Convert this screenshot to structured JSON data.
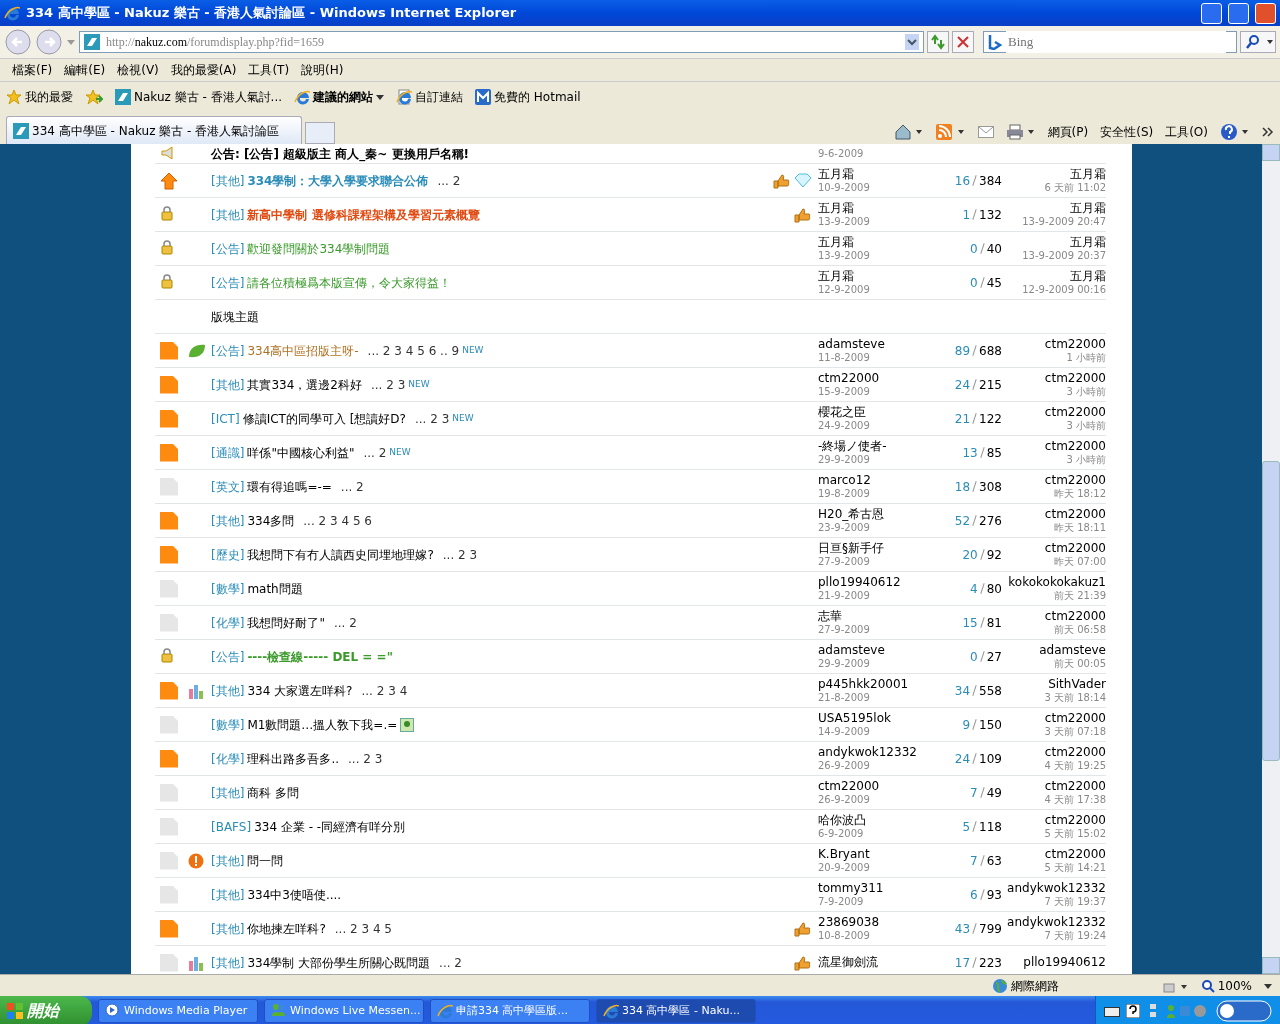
{
  "window": {
    "title": "334 高中學區 - Nakuz 樂古 - 香港人氣討論區 - Windows Internet Explorer"
  },
  "address_bar": {
    "url_prefix": "http://",
    "url_host": "nakuz.com",
    "url_path": "/forumdisplay.php?fid=1659"
  },
  "search": {
    "placeholder": "Bing"
  },
  "menu": [
    "檔案(F)",
    "編輯(E)",
    "檢視(V)",
    "我的最愛(A)",
    "工具(T)",
    "說明(H)"
  ],
  "favorites_bar": {
    "favorites": "我的最愛",
    "links": [
      {
        "kind": "site",
        "label": "Nakuz 樂古 - 香港人氣討..."
      },
      {
        "kind": "suggested",
        "label": "建議的網站"
      },
      {
        "kind": "page",
        "label": "自訂連結"
      },
      {
        "kind": "hotmail",
        "label": "免費的 Hotmail"
      }
    ]
  },
  "tabs": [
    {
      "label": "334 高中學區 - Nakuz 樂古 - 香港人氣討論區",
      "selected": true
    }
  ],
  "command_bar": [
    "網頁(P)",
    "安全性(S)",
    "工具(O)"
  ],
  "threads": [
    {
      "kind": "announce",
      "title": "公告: [公告] 超級版主 商人_秦~ 更換用戶名稱!",
      "highlighted": true,
      "color": "#000000",
      "date": "9-6-2009"
    },
    {
      "kind": "up",
      "tag": "[其他]",
      "title": "334學制：大學入學要求聯合公佈",
      "highlighted": true,
      "color": "#2a8cb8",
      "pages": "... 2",
      "extras": [
        {
          "kind": "thumb"
        },
        {
          "kind": "diamond"
        }
      ],
      "author": "五月霜",
      "date": "10-9-2009",
      "replies": "16",
      "views": "384",
      "last_user": "五月霜",
      "last_time": "6 天前 11:02"
    },
    {
      "kind": "lock",
      "tag": "[其他]",
      "title": "新高中學制 選修科課程架構及學習元素概覽",
      "highlighted": true,
      "color": "#e04a10",
      "extras": [
        {
          "kind": "thumb"
        }
      ],
      "author": "五月霜",
      "date": "13-9-2009",
      "replies": "1",
      "views": "132",
      "last_user": "五月霜",
      "last_time": "13-9-2009 20:47"
    },
    {
      "kind": "lock",
      "tag": "[公告]",
      "title": "歡迎發問關於334學制問題",
      "highlighted": false,
      "color": "#3a9a2a",
      "author": "五月霜",
      "date": "13-9-2009",
      "replies": "0",
      "views": "40",
      "last_user": "五月霜",
      "last_time": "13-9-2009 20:37"
    },
    {
      "kind": "lock",
      "tag": "[公告]",
      "title": "請各位積極爲本版宣傳，令大家得益！",
      "highlighted": false,
      "color": "#3a9a2a",
      "author": "五月霜",
      "date": "12-9-2009",
      "replies": "0",
      "views": "45",
      "last_user": "五月霜",
      "last_time": "12-9-2009 00:16"
    },
    {
      "kind": "section",
      "title": "版塊主題"
    },
    {
      "kind": "hot",
      "badge": {
        "kind": "leaf"
      },
      "tag": "[公告]",
      "title": "334高中區招版主呀-",
      "highlighted": false,
      "color": "#b07020",
      "pages": "... 2 3 4 5 6 .. 9",
      "new": "NEW",
      "author": "adamsteve",
      "date": "11-8-2009",
      "replies": "89",
      "views": "688",
      "last_user": "ctm22000",
      "last_time": "1 小時前"
    },
    {
      "kind": "hot",
      "tag": "[其他]",
      "title": "其實334，選邊2科好",
      "highlighted": false,
      "pages": "... 2 3",
      "new": "NEW",
      "author": "ctm22000",
      "date": "15-9-2009",
      "replies": "24",
      "views": "215",
      "last_user": "ctm22000",
      "last_time": "3 小時前"
    },
    {
      "kind": "hot",
      "tag": "[ICT]",
      "title": "修讀ICT的同學可入 [想讀好D?",
      "highlighted": false,
      "pages": "... 2 3",
      "new": "NEW",
      "author": "櫻花之臣",
      "date": "24-9-2009",
      "replies": "21",
      "views": "122",
      "last_user": "ctm22000",
      "last_time": "3 小時前"
    },
    {
      "kind": "hot",
      "tag": "[通識]",
      "title": "咩係\"中國核心利益\"",
      "highlighted": false,
      "pages": "... 2",
      "new": "NEW",
      "author": "-終場ノ使者-",
      "date": "29-9-2009",
      "replies": "13",
      "views": "85",
      "last_user": "ctm22000",
      "last_time": "3 小時前"
    },
    {
      "kind": "normal",
      "tag": "[英文]",
      "title": "環有得追嗎=-=",
      "highlighted": false,
      "pages": "... 2",
      "author": "marco12",
      "date": "19-8-2009",
      "replies": "18",
      "views": "308",
      "last_user": "ctm22000",
      "last_time": "昨天 18:12"
    },
    {
      "kind": "hot",
      "tag": "[其他]",
      "title": "334多問",
      "highlighted": false,
      "pages": "... 2 3 4 5 6",
      "author": "H20_希古恩",
      "date": "23-9-2009",
      "replies": "52",
      "views": "276",
      "last_user": "ctm22000",
      "last_time": "昨天 18:11"
    },
    {
      "kind": "hot",
      "tag": "[歷史]",
      "title": "我想問下有冇人讀西史同埋地理嫁?",
      "highlighted": false,
      "pages": "... 2 3",
      "author": "日亘§新手仔",
      "date": "27-9-2009",
      "replies": "20",
      "views": "92",
      "last_user": "ctm22000",
      "last_time": "昨天 07:00"
    },
    {
      "kind": "normal",
      "tag": "[數學]",
      "title": "math問題",
      "highlighted": false,
      "author": "pllo19940612",
      "date": "21-9-2009",
      "replies": "4",
      "views": "80",
      "last_user": "kokokokokakuz1",
      "last_time": "前天 21:39"
    },
    {
      "kind": "normal",
      "tag": "[化學]",
      "title": "我想問好耐了\"",
      "highlighted": false,
      "pages": "... 2",
      "author": "志華",
      "date": "27-9-2009",
      "replies": "15",
      "views": "81",
      "last_user": "ctm22000",
      "last_time": "前天 06:58"
    },
    {
      "kind": "lock",
      "tag": "[公告]",
      "title": "----檢查線----- DEL = =\"",
      "highlighted": true,
      "color": "#3a9a2a",
      "author": "adamsteve",
      "date": "29-9-2009",
      "replies": "0",
      "views": "27",
      "last_user": "adamsteve",
      "last_time": "前天 00:05"
    },
    {
      "kind": "hot",
      "badge": {
        "kind": "poll"
      },
      "tag": "[其他]",
      "title": "334 大家選左咩科?",
      "highlighted": false,
      "pages": "... 2 3 4",
      "author": "p445hkk20001",
      "date": "21-8-2009",
      "replies": "34",
      "views": "558",
      "last_user": "SithVader",
      "last_time": "3 天前 18:14"
    },
    {
      "kind": "normal",
      "tag": "[數學]",
      "title": "M1數問題…搵人敎下我=.=",
      "highlighted": false,
      "title_icons": [
        {
          "kind": "image"
        }
      ],
      "author": "USA5195lok",
      "date": "14-9-2009",
      "replies": "9",
      "views": "150",
      "last_user": "ctm22000",
      "last_time": "3 天前 07:18"
    },
    {
      "kind": "hot",
      "tag": "[化學]",
      "title": "理科出路多吾多..",
      "highlighted": false,
      "pages": "... 2 3",
      "author": "andykwok12332",
      "date": "26-9-2009",
      "replies": "24",
      "views": "109",
      "last_user": "ctm22000",
      "last_time": "4 天前 19:25"
    },
    {
      "kind": "normal",
      "tag": "[其他]",
      "title": "商科 多問",
      "highlighted": false,
      "author": "ctm22000",
      "date": "26-9-2009",
      "replies": "7",
      "views": "49",
      "last_user": "ctm22000",
      "last_time": "4 天前 17:38"
    },
    {
      "kind": "normal",
      "tag": "[BAFS]",
      "title": "334 企業 - -同經濟有咩分別",
      "highlighted": false,
      "author": "哈你波凸",
      "date": "6-9-2009",
      "replies": "5",
      "views": "118",
      "last_user": "ctm22000",
      "last_time": "5 天前 15:02"
    },
    {
      "kind": "normal",
      "badge": {
        "kind": "alert"
      },
      "tag": "[其他]",
      "title": "問一問",
      "highlighted": false,
      "author": "K.Bryant",
      "date": "20-9-2009",
      "replies": "7",
      "views": "63",
      "last_user": "ctm22000",
      "last_time": "5 天前 14:21"
    },
    {
      "kind": "normal",
      "tag": "[其他]",
      "title": "334中3使唔使....",
      "highlighted": false,
      "author": "tommy311",
      "date": "7-9-2009",
      "replies": "6",
      "views": "93",
      "last_user": "andykwok12332",
      "last_time": "7 天前 19:37"
    },
    {
      "kind": "hot",
      "tag": "[其他]",
      "title": "你地揀左咩科?",
      "highlighted": false,
      "pages": "... 2 3 4 5",
      "extras": [
        {
          "kind": "thumb"
        }
      ],
      "author": "23869038",
      "date": "10-8-2009",
      "replies": "43",
      "views": "799",
      "last_user": "andykwok12332",
      "last_time": "7 天前 19:24"
    },
    {
      "kind": "normal",
      "badge": {
        "kind": "poll"
      },
      "tag": "[其他]",
      "title": "334學制 大部份學生所關心既問題",
      "highlighted": false,
      "pages": "... 2",
      "extras": [
        {
          "kind": "thumb"
        }
      ],
      "author": "流星御劍流",
      "replies": "17",
      "views": "223",
      "last_user": "pllo19940612"
    }
  ],
  "status_bar": {
    "zone": "網際網路",
    "zoom": "100%"
  },
  "taskbar": {
    "start": "開始",
    "tasks": [
      {
        "kind": "media",
        "label": "Windows Media Player",
        "selected": false
      },
      {
        "kind": "messenger",
        "label": "Windows Live Messen...",
        "selected": false
      },
      {
        "kind": "ie",
        "label": "申請334 高中學區版...",
        "selected": false
      },
      {
        "kind": "ie",
        "label": "334 高中學區 - Naku...",
        "selected": true
      }
    ]
  }
}
